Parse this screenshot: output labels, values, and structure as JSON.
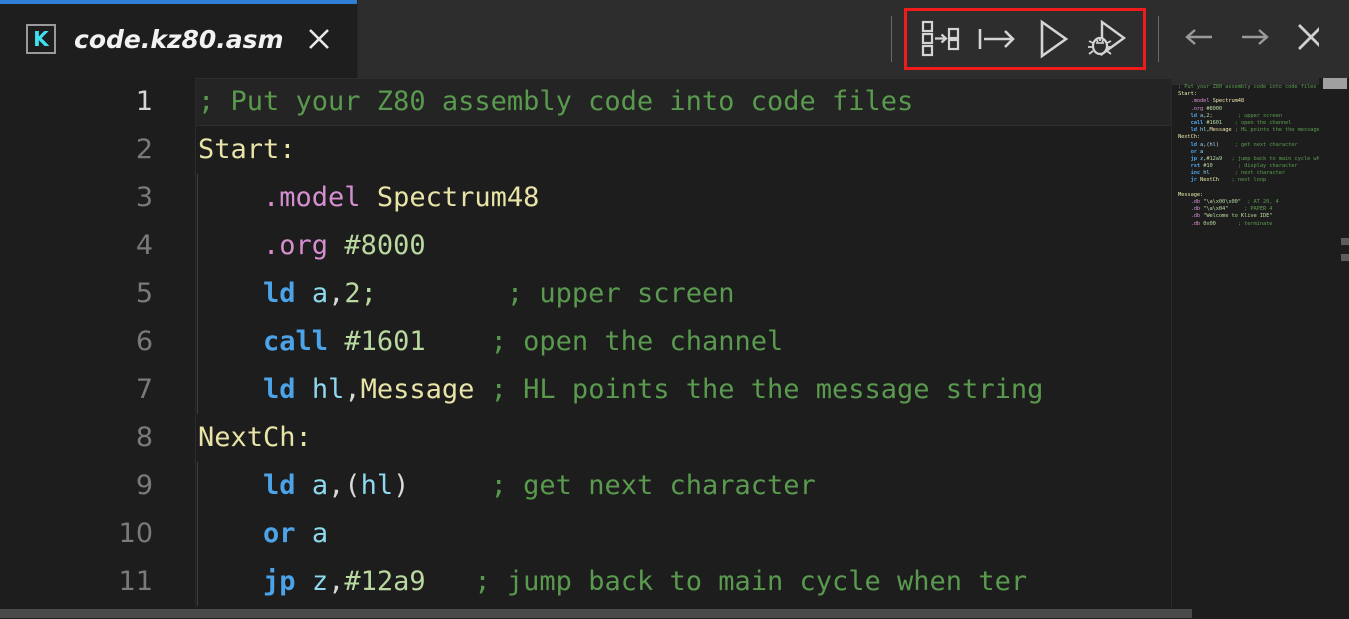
{
  "window": {
    "title": "code.kz80.asm"
  },
  "tab": {
    "icon_label": "K",
    "filename": "code.kz80.asm",
    "close_icon": "close-icon"
  },
  "toolbar": {
    "highlight_color": "#f01c1c",
    "buttons": [
      {
        "name": "compile-button",
        "icon": "compile-icon",
        "label": "Compile"
      },
      {
        "name": "run-to-button",
        "icon": "step-arrow-icon",
        "label": "Run to cursor"
      },
      {
        "name": "run-button",
        "icon": "play-icon",
        "label": "Run"
      },
      {
        "name": "debug-button",
        "icon": "debug-bug-icon",
        "label": "Debug"
      }
    ],
    "nav": [
      {
        "name": "back-button",
        "icon": "arrow-left-icon",
        "label": "Back"
      },
      {
        "name": "forward-button",
        "icon": "arrow-right-icon",
        "label": "Forward"
      },
      {
        "name": "close-window-button",
        "icon": "close-icon",
        "label": "Close"
      }
    ]
  },
  "editor": {
    "language": "z80-assembly",
    "active_line": 1,
    "first_visible_line": 1,
    "last_visible_line": 11,
    "colors": {
      "background": "#1d1d1d",
      "active_line_background": "#242424",
      "comment": "#5a9a4e",
      "directive": "#d58fd0",
      "label": "#e8e4a8",
      "keyword": "#4da3e8",
      "register": "#8fd9f0",
      "number": "#b9d9a0",
      "punctuation": "#d8d8d8",
      "line_number": "#7a7a7a",
      "line_number_active": "#d6d6d6"
    },
    "line_numbers": [
      "1",
      "2",
      "3",
      "4",
      "5",
      "6",
      "7",
      "8",
      "9",
      "10",
      "11"
    ],
    "lines": [
      {
        "n": 1,
        "active": true,
        "indent": 0,
        "tokens": [
          {
            "c": "t-com",
            "t": "; Put your Z80 assembly code into code files"
          }
        ]
      },
      {
        "n": 2,
        "active": false,
        "indent": 0,
        "tokens": [
          {
            "c": "t-lbl",
            "t": "Start:"
          }
        ]
      },
      {
        "n": 3,
        "active": false,
        "indent": 1,
        "tokens": [
          {
            "c": "t-pun",
            "t": "    "
          },
          {
            "c": "t-dir",
            "t": ".model"
          },
          {
            "c": "t-pun",
            "t": " "
          },
          {
            "c": "t-id",
            "t": "Spectrum48"
          }
        ]
      },
      {
        "n": 4,
        "active": false,
        "indent": 1,
        "tokens": [
          {
            "c": "t-pun",
            "t": "    "
          },
          {
            "c": "t-dir",
            "t": ".org"
          },
          {
            "c": "t-pun",
            "t": " "
          },
          {
            "c": "t-num",
            "t": "#8000"
          }
        ]
      },
      {
        "n": 5,
        "active": false,
        "indent": 1,
        "tokens": [
          {
            "c": "t-pun",
            "t": "    "
          },
          {
            "c": "t-kw",
            "t": "ld"
          },
          {
            "c": "t-pun",
            "t": " "
          },
          {
            "c": "t-reg",
            "t": "a"
          },
          {
            "c": "t-pun",
            "t": ","
          },
          {
            "c": "t-num",
            "t": "2;"
          },
          {
            "c": "t-pun",
            "t": "        "
          },
          {
            "c": "t-com",
            "t": "; upper screen"
          }
        ]
      },
      {
        "n": 6,
        "active": false,
        "indent": 1,
        "tokens": [
          {
            "c": "t-pun",
            "t": "    "
          },
          {
            "c": "t-kw",
            "t": "call"
          },
          {
            "c": "t-pun",
            "t": " "
          },
          {
            "c": "t-num",
            "t": "#1601"
          },
          {
            "c": "t-pun",
            "t": "    "
          },
          {
            "c": "t-com",
            "t": "; open the channel"
          }
        ]
      },
      {
        "n": 7,
        "active": false,
        "indent": 1,
        "tokens": [
          {
            "c": "t-pun",
            "t": "    "
          },
          {
            "c": "t-kw",
            "t": "ld"
          },
          {
            "c": "t-pun",
            "t": " "
          },
          {
            "c": "t-reg",
            "t": "hl"
          },
          {
            "c": "t-pun",
            "t": ","
          },
          {
            "c": "t-id",
            "t": "Message"
          },
          {
            "c": "t-pun",
            "t": " "
          },
          {
            "c": "t-com",
            "t": "; HL points the the message string"
          }
        ]
      },
      {
        "n": 8,
        "active": false,
        "indent": 0,
        "tokens": [
          {
            "c": "t-lbl",
            "t": "NextCh:"
          }
        ]
      },
      {
        "n": 9,
        "active": false,
        "indent": 1,
        "tokens": [
          {
            "c": "t-pun",
            "t": "    "
          },
          {
            "c": "t-kw",
            "t": "ld"
          },
          {
            "c": "t-pun",
            "t": " "
          },
          {
            "c": "t-reg",
            "t": "a"
          },
          {
            "c": "t-pun",
            "t": ",("
          },
          {
            "c": "t-reg",
            "t": "hl"
          },
          {
            "c": "t-pun",
            "t": ")"
          },
          {
            "c": "t-pun",
            "t": "     "
          },
          {
            "c": "t-com",
            "t": "; get next character"
          }
        ]
      },
      {
        "n": 10,
        "active": false,
        "indent": 1,
        "tokens": [
          {
            "c": "t-pun",
            "t": "    "
          },
          {
            "c": "t-kw",
            "t": "or"
          },
          {
            "c": "t-pun",
            "t": " "
          },
          {
            "c": "t-reg",
            "t": "a"
          }
        ]
      },
      {
        "n": 11,
        "active": false,
        "indent": 1,
        "tokens": [
          {
            "c": "t-pun",
            "t": "    "
          },
          {
            "c": "t-kw",
            "t": "jp"
          },
          {
            "c": "t-pun",
            "t": " "
          },
          {
            "c": "t-reg",
            "t": "z"
          },
          {
            "c": "t-pun",
            "t": ","
          },
          {
            "c": "t-num",
            "t": "#12a9"
          },
          {
            "c": "t-pun",
            "t": "   "
          },
          {
            "c": "t-com",
            "t": "; jump back to main cycle when ter"
          }
        ]
      }
    ]
  },
  "minimap": {
    "lines": [
      {
        "tokens": [
          {
            "c": "t-com",
            "t": "; Put your Z80 assembly code into code files"
          }
        ]
      },
      {
        "tokens": [
          {
            "c": "t-lbl",
            "t": "Start:"
          }
        ]
      },
      {
        "tokens": [
          {
            "c": "t-pun",
            "t": "    "
          },
          {
            "c": "t-dir",
            "t": ".model"
          },
          {
            "c": "t-pun",
            "t": " "
          },
          {
            "c": "t-id",
            "t": "Spectrum48"
          }
        ]
      },
      {
        "tokens": [
          {
            "c": "t-pun",
            "t": "    "
          },
          {
            "c": "t-dir",
            "t": ".org"
          },
          {
            "c": "t-pun",
            "t": " "
          },
          {
            "c": "t-num",
            "t": "#8000"
          }
        ]
      },
      {
        "tokens": [
          {
            "c": "t-pun",
            "t": "    "
          },
          {
            "c": "t-kw",
            "t": "ld"
          },
          {
            "c": "t-pun",
            "t": " "
          },
          {
            "c": "t-reg",
            "t": "a"
          },
          {
            "c": "t-pun",
            "t": ","
          },
          {
            "c": "t-num",
            "t": "2;"
          },
          {
            "c": "t-pun",
            "t": "        "
          },
          {
            "c": "t-com",
            "t": "; upper screen"
          }
        ]
      },
      {
        "tokens": [
          {
            "c": "t-pun",
            "t": "    "
          },
          {
            "c": "t-kw",
            "t": "call"
          },
          {
            "c": "t-pun",
            "t": " "
          },
          {
            "c": "t-num",
            "t": "#1601"
          },
          {
            "c": "t-pun",
            "t": "    "
          },
          {
            "c": "t-com",
            "t": "; open the channel"
          }
        ]
      },
      {
        "tokens": [
          {
            "c": "t-pun",
            "t": "    "
          },
          {
            "c": "t-kw",
            "t": "ld"
          },
          {
            "c": "t-pun",
            "t": " "
          },
          {
            "c": "t-reg",
            "t": "hl"
          },
          {
            "c": "t-pun",
            "t": ","
          },
          {
            "c": "t-id",
            "t": "Message"
          },
          {
            "c": "t-pun",
            "t": " "
          },
          {
            "c": "t-com",
            "t": "; HL points the the message string"
          }
        ]
      },
      {
        "tokens": [
          {
            "c": "t-lbl",
            "t": "NextCh:"
          }
        ]
      },
      {
        "tokens": [
          {
            "c": "t-pun",
            "t": "    "
          },
          {
            "c": "t-kw",
            "t": "ld"
          },
          {
            "c": "t-pun",
            "t": " "
          },
          {
            "c": "t-reg",
            "t": "a"
          },
          {
            "c": "t-pun",
            "t": ",("
          },
          {
            "c": "t-reg",
            "t": "hl"
          },
          {
            "c": "t-pun",
            "t": ")"
          },
          {
            "c": "t-pun",
            "t": "     "
          },
          {
            "c": "t-com",
            "t": "; get next character"
          }
        ]
      },
      {
        "tokens": [
          {
            "c": "t-pun",
            "t": "    "
          },
          {
            "c": "t-kw",
            "t": "or"
          },
          {
            "c": "t-pun",
            "t": " "
          },
          {
            "c": "t-reg",
            "t": "a"
          }
        ]
      },
      {
        "tokens": [
          {
            "c": "t-pun",
            "t": "    "
          },
          {
            "c": "t-kw",
            "t": "jp"
          },
          {
            "c": "t-pun",
            "t": " "
          },
          {
            "c": "t-reg",
            "t": "z"
          },
          {
            "c": "t-pun",
            "t": ","
          },
          {
            "c": "t-num",
            "t": "#12a9"
          },
          {
            "c": "t-pun",
            "t": "   "
          },
          {
            "c": "t-com",
            "t": "; jump back to main cycle when terminator"
          }
        ]
      },
      {
        "tokens": [
          {
            "c": "t-pun",
            "t": "    "
          },
          {
            "c": "t-kw",
            "t": "rst"
          },
          {
            "c": "t-pun",
            "t": " "
          },
          {
            "c": "t-num",
            "t": "#10"
          },
          {
            "c": "t-pun",
            "t": "        "
          },
          {
            "c": "t-com",
            "t": "; display character"
          }
        ]
      },
      {
        "tokens": [
          {
            "c": "t-pun",
            "t": "    "
          },
          {
            "c": "t-kw",
            "t": "inc"
          },
          {
            "c": "t-pun",
            "t": " "
          },
          {
            "c": "t-reg",
            "t": "hl"
          },
          {
            "c": "t-pun",
            "t": "        "
          },
          {
            "c": "t-com",
            "t": "; next character"
          }
        ]
      },
      {
        "tokens": [
          {
            "c": "t-pun",
            "t": "    "
          },
          {
            "c": "t-kw",
            "t": "jr"
          },
          {
            "c": "t-pun",
            "t": " "
          },
          {
            "c": "t-id",
            "t": "NextCh"
          },
          {
            "c": "t-pun",
            "t": "    "
          },
          {
            "c": "t-com",
            "t": "; next loop"
          }
        ]
      },
      {
        "tokens": []
      },
      {
        "tokens": [
          {
            "c": "t-lbl",
            "t": "Message:"
          }
        ]
      },
      {
        "tokens": [
          {
            "c": "t-pun",
            "t": "    "
          },
          {
            "c": "t-dir",
            "t": ".db"
          },
          {
            "c": "t-pun",
            "t": " "
          },
          {
            "c": "t-num",
            "t": "\"\\a\\x00\\x00\""
          },
          {
            "c": "t-pun",
            "t": "  "
          },
          {
            "c": "t-com",
            "t": "; AT 20, 4"
          }
        ]
      },
      {
        "tokens": [
          {
            "c": "t-pun",
            "t": "    "
          },
          {
            "c": "t-dir",
            "t": ".db"
          },
          {
            "c": "t-pun",
            "t": " "
          },
          {
            "c": "t-num",
            "t": "\"\\a\\x04\""
          },
          {
            "c": "t-pun",
            "t": "     "
          },
          {
            "c": "t-com",
            "t": "; PAPER 4"
          }
        ]
      },
      {
        "tokens": [
          {
            "c": "t-pun",
            "t": "    "
          },
          {
            "c": "t-dir",
            "t": ".db"
          },
          {
            "c": "t-pun",
            "t": " "
          },
          {
            "c": "t-num",
            "t": "\"Welcome to Klive IDE\""
          }
        ]
      },
      {
        "tokens": [
          {
            "c": "t-pun",
            "t": "    "
          },
          {
            "c": "t-dir",
            "t": ".db"
          },
          {
            "c": "t-pun",
            "t": " "
          },
          {
            "c": "t-num",
            "t": "0x00"
          },
          {
            "c": "t-pun",
            "t": "       "
          },
          {
            "c": "t-com",
            "t": "; terminate"
          }
        ]
      }
    ]
  },
  "scroll": {
    "vertical_thumb_at_top": true,
    "horizontal_visible": true
  }
}
